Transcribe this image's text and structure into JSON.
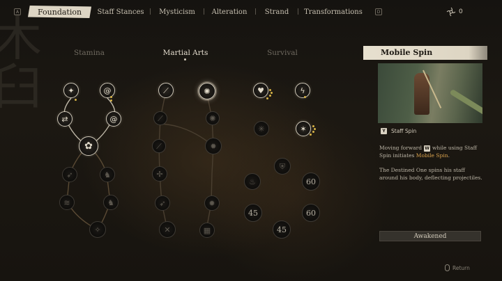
{
  "tabs": {
    "left_key": "A",
    "right_key": "D",
    "items": [
      {
        "label": "Foundation",
        "active": true
      },
      {
        "label": "Staff Stances",
        "active": false
      },
      {
        "label": "Mysticism",
        "active": false
      },
      {
        "label": "Alteration",
        "active": false
      },
      {
        "label": "Strand",
        "active": false
      },
      {
        "label": "Transformations",
        "active": false
      }
    ]
  },
  "currency": {
    "icon": "spark-icon",
    "value": "0"
  },
  "columns": [
    {
      "label": "Stamina",
      "active": false
    },
    {
      "label": "Martial Arts",
      "active": true
    },
    {
      "label": "Survival",
      "active": false
    }
  ],
  "tree": {
    "locked_values": [
      "60",
      "45",
      "60",
      "45"
    ]
  },
  "panel": {
    "title": "Mobile Spin",
    "skill_key": "Y",
    "skill_name": "Staff Spin",
    "desc1_pre": "Moving forward",
    "desc1_key": "W",
    "desc1_mid": "while using Staff Spin initiates",
    "desc1_hl": "Mobile Spin",
    "desc1_end": ".",
    "desc2": "The Destined One spins his staff around his body, deflecting projectiles.",
    "status": "Awakened"
  },
  "footer": {
    "return_label": "Return"
  },
  "colors": {
    "accent_gold": "#d8b447",
    "highlight": "#d9a24e",
    "tab_active_bg": "#ddd5c4"
  }
}
